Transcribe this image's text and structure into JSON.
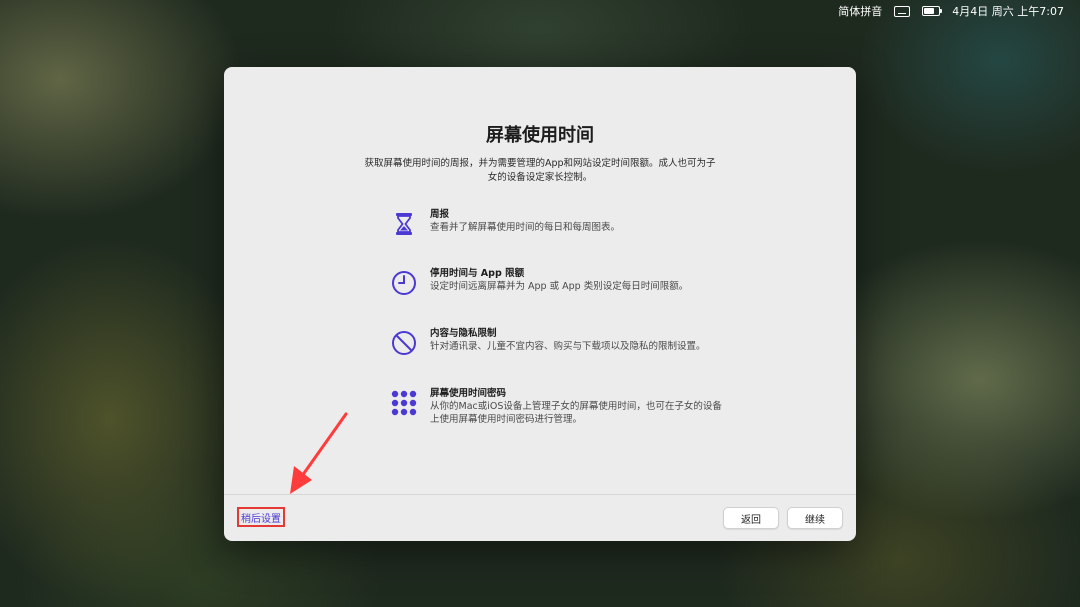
{
  "menubar": {
    "input_method": "简体拼音",
    "datetime": "4月4日 周六 上午7:07",
    "keyboard_icon": "keyboard-icon",
    "battery_icon": "battery-charging-icon"
  },
  "dialog": {
    "title": "屏幕使用时间",
    "description": "获取屏幕使用时间的周报，并为需要管理的App和网站设定时间限额。成人也可为子女的设备设定家长控制。",
    "features": [
      {
        "icon": "hourglass-icon",
        "title": "周报",
        "desc": "查看并了解屏幕使用时间的每日和每周图表。"
      },
      {
        "icon": "clock-icon",
        "title": "停用时间与 App 限额",
        "desc": "设定时间远离屏幕并为 App 或 App 类别设定每日时间限额。"
      },
      {
        "icon": "prohibited-icon",
        "title": "内容与隐私限制",
        "desc": "针对通讯录、儿童不宜内容、购买与下载项以及隐私的限制设置。"
      },
      {
        "icon": "passcode-dots-icon",
        "title": "屏幕使用时间密码",
        "desc": "从你的Mac或iOS设备上管理子女的屏幕使用时间，也可在子女的设备上使用屏幕使用时间密码进行管理。"
      }
    ],
    "later_label": "稍后设置",
    "back_label": "返回",
    "continue_label": "继续"
  },
  "colors": {
    "accent": "#4b39d4",
    "highlight_box": "#e53935",
    "arrow": "#ff3b3b"
  }
}
